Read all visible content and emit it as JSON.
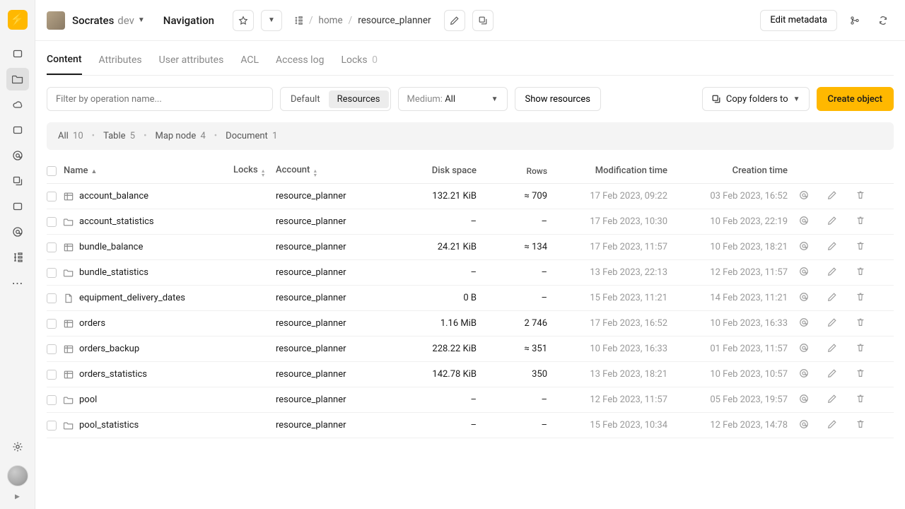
{
  "header": {
    "cluster": "Socrates",
    "env": "dev",
    "nav_title": "Navigation",
    "breadcrumb": {
      "home": "home",
      "current": "resource_planner"
    },
    "edit_metadata": "Edit metadata"
  },
  "tabs": [
    {
      "label": "Content",
      "active": true
    },
    {
      "label": "Attributes"
    },
    {
      "label": "User attributes"
    },
    {
      "label": "ACL"
    },
    {
      "label": "Access log"
    },
    {
      "label": "Locks",
      "count": "0"
    }
  ],
  "toolbar": {
    "filter_placeholder": "Filter by operation name...",
    "seg_default": "Default",
    "seg_resources": "Resources",
    "medium_label": "Medium:",
    "medium_value": "All",
    "show_resources": "Show resources",
    "copy_folders": "Copy folders to",
    "create": "Create object"
  },
  "summary": {
    "all_label": "All",
    "all": "10",
    "table_label": "Table",
    "table": "5",
    "map_label": "Map node",
    "map": "4",
    "doc_label": "Document",
    "doc": "1"
  },
  "columns": {
    "name": "Name",
    "locks": "Locks",
    "account": "Account",
    "disk": "Disk space",
    "rows": "Rows",
    "mod": "Modification time",
    "created": "Creation time"
  },
  "rows": [
    {
      "icon": "table",
      "name": "account_balance",
      "account": "resource_planner",
      "disk": "132.21 KiB",
      "rows": "≈ 709",
      "mod": "17 Feb 2023, 09:22",
      "created": "03 Feb 2023,  16:52"
    },
    {
      "icon": "folder",
      "name": "account_statistics",
      "account": "resource_planner",
      "disk": "–",
      "rows": "–",
      "mod": "17 Feb 2023,  10:30",
      "created": "10 Feb 2023, 22:19"
    },
    {
      "icon": "table",
      "name": "bundle_balance",
      "account": "resource_planner",
      "disk": "24.21 KiB",
      "rows": "≈ 134",
      "mod": "17 Feb 2023, 11:57",
      "created": "10 Feb 2023, 18:21"
    },
    {
      "icon": "folder",
      "name": "bundle_statistics",
      "account": "resource_planner",
      "disk": "–",
      "rows": "–",
      "mod": "13 Feb 2023, 22:13",
      "created": "12 Feb 2023, 11:57"
    },
    {
      "icon": "document",
      "name": "equipment_delivery_dates",
      "account": "resource_planner",
      "disk": "0 B",
      "rows": "–",
      "mod": "15 Feb 2023, 11:21",
      "created": "14 Feb 2023, 11:21"
    },
    {
      "icon": "table",
      "name": "orders",
      "account": "resource_planner",
      "disk": "1.16 MiB",
      "rows": "2 746",
      "mod": "17 Feb 2023, 16:52",
      "created": "10 Feb 2023, 16:33"
    },
    {
      "icon": "table",
      "name": "orders_backup",
      "account": "resource_planner",
      "disk": "228.22 KiB",
      "rows": "≈ 351",
      "mod": "10 Feb 2023, 16:33",
      "created": "01 Feb 2023, 11:57"
    },
    {
      "icon": "table",
      "name": "orders_statistics",
      "account": "resource_planner",
      "disk": "142.78 KiB",
      "rows": "350",
      "mod": "13 Feb 2023, 18:21",
      "created": "10 Feb 2023, 10:57"
    },
    {
      "icon": "folder",
      "name": "pool",
      "account": "resource_planner",
      "disk": "–",
      "rows": "–",
      "mod": "12 Feb 2023, 11:57",
      "created": "05 Feb 2023, 19:57"
    },
    {
      "icon": "folder",
      "name": "pool_statistics",
      "account": "resource_planner",
      "disk": "–",
      "rows": "–",
      "mod": "15 Feb 2023, 10:34",
      "created": "12 Feb 2023, 14:78"
    }
  ]
}
